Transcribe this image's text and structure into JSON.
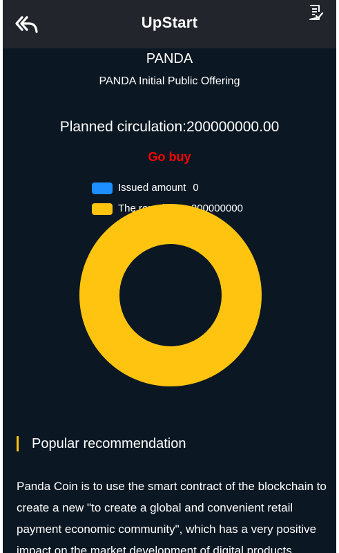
{
  "header": {
    "title": "UpStart",
    "back_icon": "double-reply-arrow",
    "record_icon": "document-check-icon"
  },
  "coin": {
    "name": "PANDA",
    "subtitle": "PANDA Initial Public Offering",
    "circulation": "Planned circulation:200000000.00",
    "buy_label": "Go buy"
  },
  "colors": {
    "background": "#0b1722",
    "topbar": "#22262c",
    "issued": "#1e8fff",
    "remaining": "#ffc410",
    "buy": "#ff0000"
  },
  "chart_data": {
    "type": "pie",
    "style": "donut",
    "legend_position": "top-center",
    "series": [
      {
        "name": "Issued amount",
        "label": "Issued amount",
        "display_value": "0",
        "value": 0,
        "color": "#1e8fff"
      },
      {
        "name": "The remaining",
        "label": "The remaining",
        "display_value": "200000000",
        "value": 200000000,
        "color": "#ffc410"
      }
    ]
  },
  "section": {
    "title": "Popular recommendation",
    "description": "Panda Coin is to use the smart contract of the blockchain to create a new \"to create a global and convenient retail payment economic community\", which has a very positive impact on the market development of digital products"
  }
}
